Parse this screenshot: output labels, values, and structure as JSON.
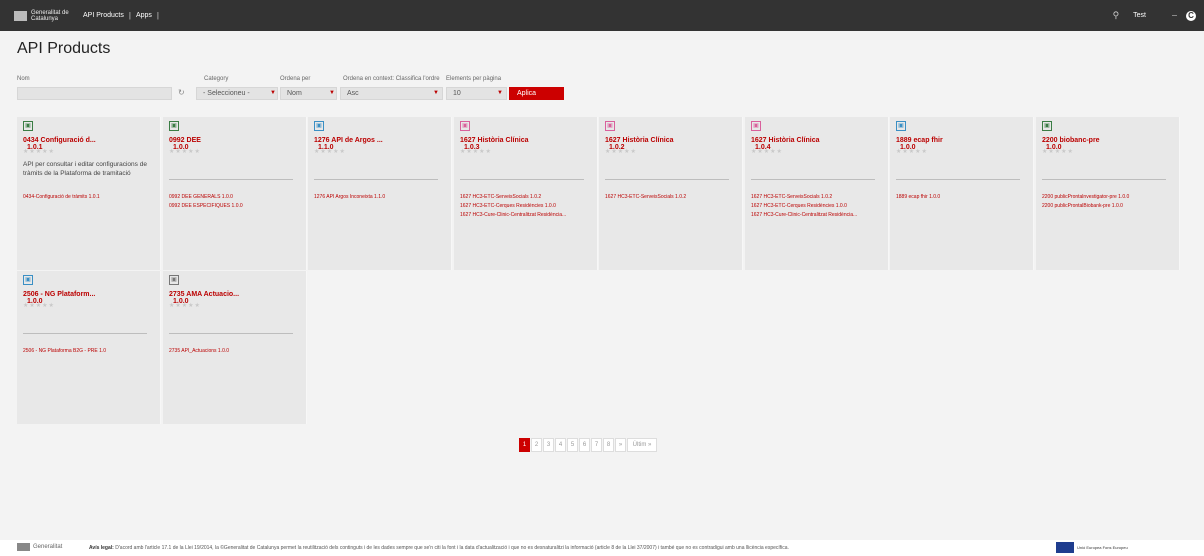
{
  "header": {
    "logo_text": "Generalitat de Catalunya",
    "nav": [
      "API Products",
      "Apps"
    ],
    "nav_separator": "|",
    "search_icon": "search-icon",
    "user_name": "Test",
    "user_avatar_letter": "C"
  },
  "page": {
    "title": "API Products"
  },
  "filters": {
    "name_label": "Nom",
    "name_value": "",
    "category_label": "Category",
    "category_value": "- Seleccioneu -",
    "order_by_label": "Ordena per",
    "order_by_value": "Nom",
    "context_label": "Ordena en context: Classifica l'ordre",
    "context_value": "Asc",
    "per_page_label": "Elements per pàgina",
    "per_page_value": "10",
    "apply_label": "Aplica"
  },
  "products": [
    {
      "name": "0434 Configuració d...",
      "version": "1.0.1",
      "icon_color": "#3a7d44",
      "description": "API per consultar i editar configuracions de tràmits de la Plataforma de tramitació",
      "links": [
        "0434-Configuració de tràmits  1.0.1"
      ]
    },
    {
      "name": "0992 DEE",
      "version": "1.0.0",
      "icon_color": "#3a7d44",
      "description": "",
      "links": [
        "0992 DEE GENERALS  1.0.0",
        "0992 DEE ESPECIFIQUES  1.0.0"
      ]
    },
    {
      "name": "1276 API de Argos ...",
      "version": "1.1.0",
      "icon_color": "#3a8fc4",
      "description": "",
      "links": [
        "1276 API Argos Inconeixta  1.1.0"
      ]
    },
    {
      "name": "1627 Història Clínica",
      "version": "1.0.3",
      "icon_color": "#d9609c",
      "description": "",
      "links": [
        "1627 HC3-ETC-ServeisSocials  1.0.2",
        "1627 HC3-ETC-Cerques Residències  1.0.0",
        "1627 HC3-Cure-Clinic-Centralitzat Residència..."
      ]
    },
    {
      "name": "1627 Història Clínica",
      "version": "1.0.2",
      "icon_color": "#d9609c",
      "description": "",
      "links": [
        "1627 HC3-ETC-ServeisSocials  1.0.2"
      ]
    },
    {
      "name": "1627 Història Clínica",
      "version": "1.0.4",
      "icon_color": "#d9609c",
      "description": "",
      "links": [
        "1627 HC3-ETC-ServeisSocials  1.0.2",
        "1627 HC3-ETC-Cerques Residències  1.0.0",
        "1627 HC3-Cure-Clinic-Centralitzat Residència..."
      ]
    },
    {
      "name": "1889 ecap fhir",
      "version": "1.0.0",
      "icon_color": "#3a8fc4",
      "description": "",
      "links": [
        "1889 ecap fhir  1.0.0"
      ]
    },
    {
      "name": "2200 biobanc-pre",
      "version": "1.0.0",
      "icon_color": "#3a7d44",
      "description": "",
      "links": [
        "2200 publicProntalnvestigator-pre  1.0.0",
        "2200 publicProntalBiobank-pre  1.0.0"
      ]
    },
    {
      "name": "2506 - NG Plataform...",
      "version": "1.0.0",
      "icon_color": "#3a8fc4",
      "description": "",
      "links": [
        "2506 - NG Plataforma B2G - PRE  1.0"
      ]
    },
    {
      "name": "2735 AMA Actuacio...",
      "version": "1.0.0",
      "icon_color": "#777777",
      "description": "",
      "links": [
        "2735 API_Actuacions  1.0.0"
      ]
    }
  ],
  "stars": "★★★★★",
  "pagination": {
    "pages": [
      "1",
      "2",
      "3",
      "4",
      "5",
      "6",
      "7",
      "8"
    ],
    "next": "»",
    "last": "Últim »",
    "active": "1"
  },
  "footer": {
    "logo_text": "Generalitat",
    "legal_title": "Avís legal:",
    "legal_text": "D'acord amb l'article 17.1 de la Llei 19/2014, la ©Generalitat de Catalunya permet la reutilització dels continguts i de les dades sempre que se'n citi la font i la data d'actualització i que no es desnaturalitzi la informació (article 8 de la Llei 37/2007) i també que no es contradigui amb una llicència específica.",
    "eu_text": "Unió Europea Fons Europeu"
  },
  "colors": {
    "brand_red": "#cc0000",
    "topbar": "#333333"
  }
}
